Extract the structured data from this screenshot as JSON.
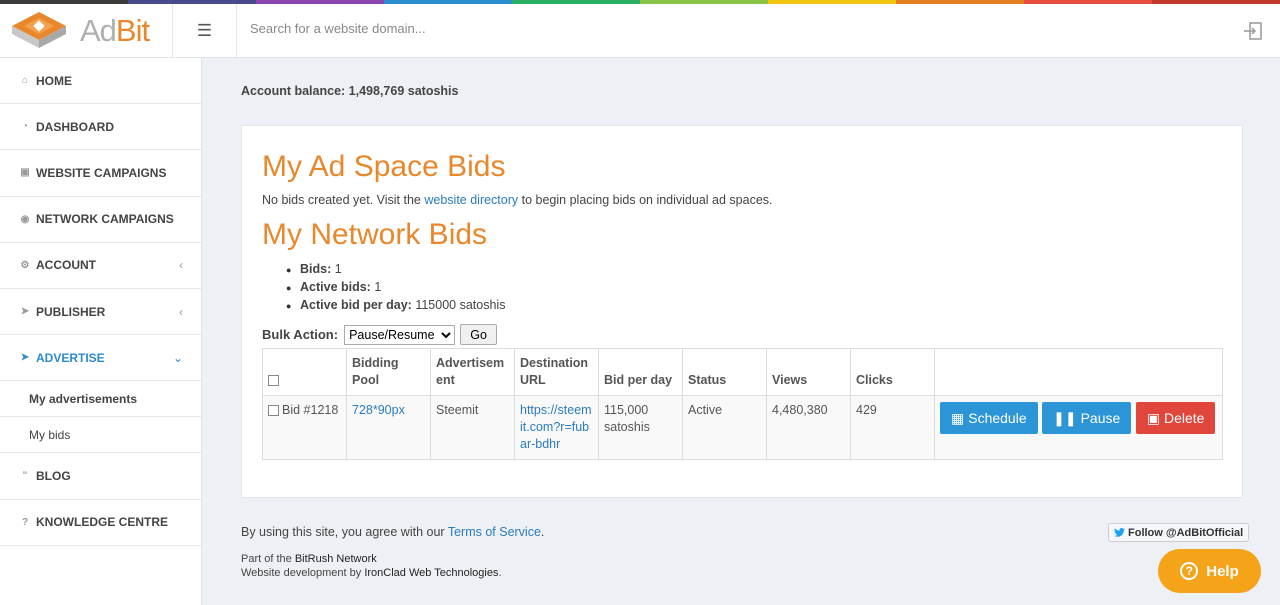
{
  "brand": {
    "name_prefix": "Ad",
    "name_suffix": "Bit",
    "colors": [
      "#3b3b3b",
      "#4a4a8c",
      "#8e44ad",
      "#2b8ccf",
      "#27ae60",
      "#8bc34a",
      "#f1c40f",
      "#e67e22",
      "#e74c3c",
      "#c0392b"
    ]
  },
  "search": {
    "placeholder": "Search for a website domain..."
  },
  "sidebar": {
    "items": [
      {
        "label": "HOME"
      },
      {
        "label": "DASHBOARD"
      },
      {
        "label": "WEBSITE CAMPAIGNS"
      },
      {
        "label": "NETWORK CAMPAIGNS"
      },
      {
        "label": "ACCOUNT"
      },
      {
        "label": "PUBLISHER"
      },
      {
        "label": "ADVERTISE"
      },
      {
        "label": "My advertisements"
      },
      {
        "label": "My bids"
      },
      {
        "label": "BLOG"
      },
      {
        "label": "KNOWLEDGE CENTRE"
      }
    ]
  },
  "balance": {
    "label": "Account balance:",
    "value": "1,498,769 satoshis"
  },
  "ad_space": {
    "title": "My Ad Space Bids",
    "note_before": "No bids created yet. Visit the ",
    "note_link": "website directory",
    "note_after": " to begin placing bids on individual ad spaces."
  },
  "network": {
    "title": "My Network Bids",
    "stats": [
      {
        "label": "Bids:",
        "value": "1"
      },
      {
        "label": "Active bids:",
        "value": "1"
      },
      {
        "label": "Active bid per day:",
        "value": "115000 satoshis"
      }
    ]
  },
  "bulk": {
    "label": "Bulk Action:",
    "selected": "Pause/Resume",
    "go": "Go"
  },
  "table": {
    "headers": [
      "Bidding Pool",
      "Advertisem ent",
      "Destination URL",
      "Bid per day",
      "Status",
      "Views",
      "Clicks"
    ],
    "row": {
      "bid": "Bid #1218",
      "pool": "728*90px",
      "advertisement": "Steemit",
      "url": "https://steemit.com?r=fubar-bdhr",
      "bid_per_day": "115,000 satoshis",
      "status": "Active",
      "views": "4,480,380",
      "clicks": "429"
    },
    "actions": {
      "schedule": "Schedule",
      "pause": "Pause",
      "delete": "Delete"
    }
  },
  "footer": {
    "agree_before": "By using this site, you agree with our ",
    "tos": "Terms of Service",
    "agree_after": ".",
    "part_of": "Part of the ",
    "network_name": "BitRush Network",
    "dev_by": "Website development by ",
    "dev_name": "IronClad Web Technologies",
    "dev_after": ".",
    "follow": "Follow @AdBitOfficial",
    "help": "Help"
  }
}
